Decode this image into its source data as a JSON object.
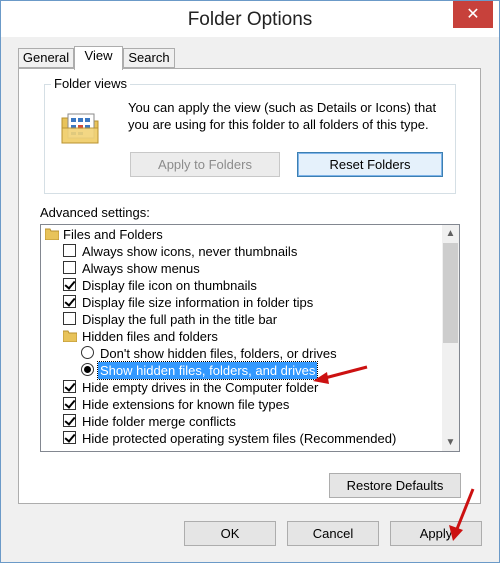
{
  "window": {
    "title": "Folder Options",
    "close_label": "✕"
  },
  "tabs": [
    {
      "label": "General",
      "active": false
    },
    {
      "label": "View",
      "active": true
    },
    {
      "label": "Search",
      "active": false
    }
  ],
  "folder_views": {
    "group_label": "Folder views",
    "description": "You can apply the view (such as Details or Icons) that you are using for this folder to all folders of this type.",
    "apply_button": "Apply to Folders",
    "reset_button": "Reset Folders"
  },
  "advanced": {
    "label": "Advanced settings:",
    "items": [
      {
        "type": "folder",
        "label": "Files and Folders"
      },
      {
        "type": "checkbox",
        "label": "Always show icons, never thumbnails",
        "checked": false
      },
      {
        "type": "checkbox",
        "label": "Always show menus",
        "checked": false
      },
      {
        "type": "checkbox",
        "label": "Display file icon on thumbnails",
        "checked": true
      },
      {
        "type": "checkbox",
        "label": "Display file size information in folder tips",
        "checked": true
      },
      {
        "type": "checkbox",
        "label": "Display the full path in the title bar",
        "checked": false
      },
      {
        "type": "folder",
        "label": "Hidden files and folders"
      },
      {
        "type": "radio",
        "label": "Don't show hidden files, folders, or drives",
        "checked": false
      },
      {
        "type": "radio",
        "label": "Show hidden files, folders, and drives",
        "checked": true,
        "selected": true
      },
      {
        "type": "checkbox",
        "label": "Hide empty drives in the Computer folder",
        "checked": true
      },
      {
        "type": "checkbox",
        "label": "Hide extensions for known file types",
        "checked": true
      },
      {
        "type": "checkbox",
        "label": "Hide folder merge conflicts",
        "checked": true
      },
      {
        "type": "checkbox",
        "label": "Hide protected operating system files (Recommended)",
        "checked": true
      }
    ]
  },
  "restore_defaults": "Restore Defaults",
  "footer": {
    "ok": "OK",
    "cancel": "Cancel",
    "apply": "Apply"
  },
  "colors": {
    "selection": "#3399ff",
    "close": "#c7413b",
    "annotation_arrow": "#cc1111"
  },
  "icons": {
    "close": "close-icon",
    "folder_views": "folder-view-icon",
    "tree_folder": "folder-icon",
    "scroll_up": "chevron-up-icon",
    "scroll_down": "chevron-down-icon"
  }
}
